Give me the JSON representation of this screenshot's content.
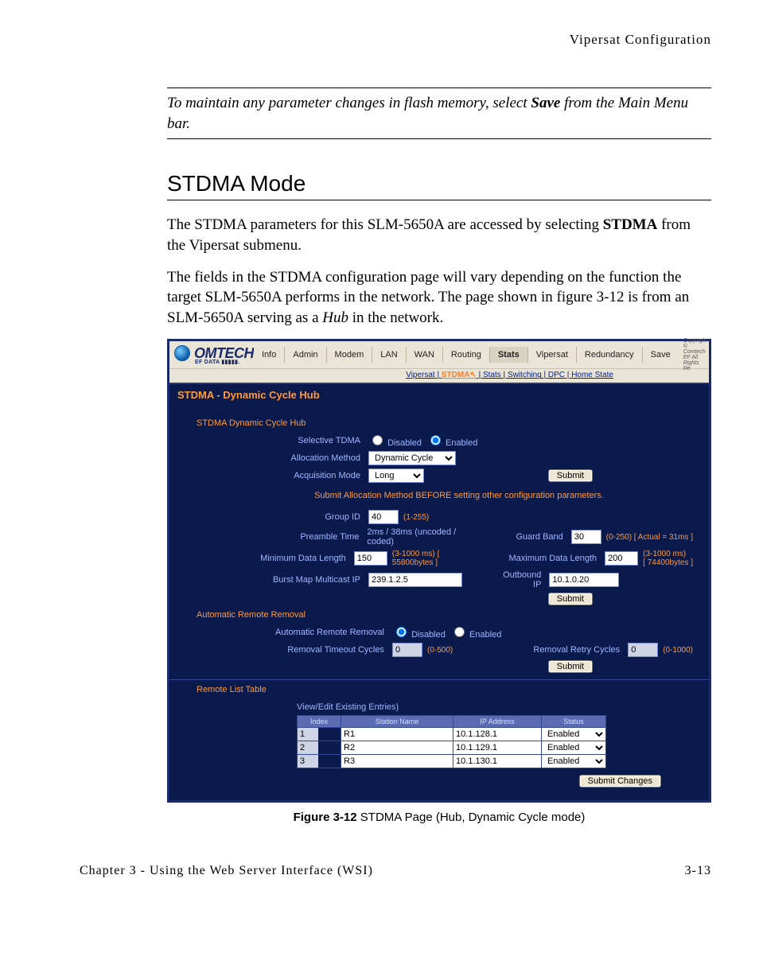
{
  "header": {
    "running": "Vipersat Configuration"
  },
  "note": {
    "pre": "To maintain any parameter changes in flash memory, select ",
    "bold": "Save",
    "post": " from the Main Menu bar."
  },
  "section_title": "STDMA Mode",
  "para1_a": "The STDMA parameters for this SLM-5650A are accessed by selecting ",
  "para1_bold": "STDMA",
  "para1_b": " from the Vipersat submenu.",
  "para2_a": "The fields in the STDMA configuration page will vary depending on the function the target SLM-5650A performs in the network. The page shown in figure 3-12 is from an SLM-5650A serving as a ",
  "para2_em": "Hub",
  "para2_b": " in the network.",
  "fig": {
    "logo_main": "OMTECH",
    "logo_sub": "EF DATA ▮▮▮▮▮.",
    "tabs": [
      "Info",
      "Admin",
      "Modem",
      "LAN",
      "WAN",
      "Routing",
      "Stats",
      "Vipersat",
      "Redundancy",
      "Save"
    ],
    "active_tab_idx": 6,
    "copyright": "Copyright ©\nComtech EF\nAll Rights Re",
    "subnav": {
      "items": [
        "Vipersat",
        "STDMA",
        "Stats",
        "Switching",
        "DPC",
        "Home State"
      ],
      "active_idx": 1
    },
    "panel_title": "STDMA - Dynamic Cycle Hub",
    "group1_title": "STDMA Dynamic Cycle Hub",
    "selective_label": "Selective TDMA",
    "selective_opts": [
      "Disabled",
      "Enabled"
    ],
    "selective_sel_idx": 1,
    "alloc_label": "Allocation Method",
    "alloc_value": "Dynamic Cycle",
    "acq_label": "Acquisition Mode",
    "acq_value": "Long",
    "submit": "Submit",
    "warn": "Submit Allocation Method BEFORE setting other configuration parameters.",
    "group_id_label": "Group ID",
    "group_id_value": "40",
    "group_id_hint": "(1-255)",
    "preamble_label": "Preamble Time",
    "preamble_value": "2ms / 38ms (uncoded / coded)",
    "guard_label": "Guard Band",
    "guard_value": "30",
    "guard_hint": "(0-250) [ Actual = 31ms ]",
    "min_label": "Minimum Data Length",
    "min_value": "150",
    "min_hint": "(3-1000 ms) [ 55800bytes ]",
    "max_label": "Maximum Data Length",
    "max_value": "200",
    "max_hint1": "(3-1000 ms)",
    "max_hint2": "[ 74400bytes ]",
    "burst_label": "Burst Map Multicast IP",
    "burst_value": "239.1.2.5",
    "out_label": "Outbound IP",
    "out_value": "10.1.0.20",
    "group2_title": "Automatic Remote Removal",
    "arr_label": "Automatic Remote Removal",
    "arr_opts": [
      "Disabled",
      "Enabled"
    ],
    "arr_sel_idx": 0,
    "rt_label": "Removal Timeout Cycles",
    "rt_value": "0",
    "rt_hint": "(0-500)",
    "rr_label": "Removal Retry Cycles",
    "rr_value": "0",
    "rr_hint": "(0-1000)",
    "group3_title": "Remote List Table",
    "tbl_title": "View/Edit Existing Entries)",
    "tbl_headers": [
      "Index",
      "Station Name",
      "IP Address",
      "Status"
    ],
    "tbl_rows": [
      {
        "idx": "1",
        "name": "R1",
        "ip": "10.1.128.1",
        "status": "Enabled"
      },
      {
        "idx": "2",
        "name": "R2",
        "ip": "10.1.129.1",
        "status": "Enabled"
      },
      {
        "idx": "3",
        "name": "R3",
        "ip": "10.1.130.1",
        "status": "Enabled"
      }
    ],
    "submit_changes": "Submit Changes"
  },
  "caption_bold": "Figure 3-12",
  "caption_rest": "   STDMA Page (Hub, Dynamic Cycle mode)",
  "footer_left": "Chapter 3 - Using the Web Server Interface (WSI)",
  "footer_right": "3-13"
}
